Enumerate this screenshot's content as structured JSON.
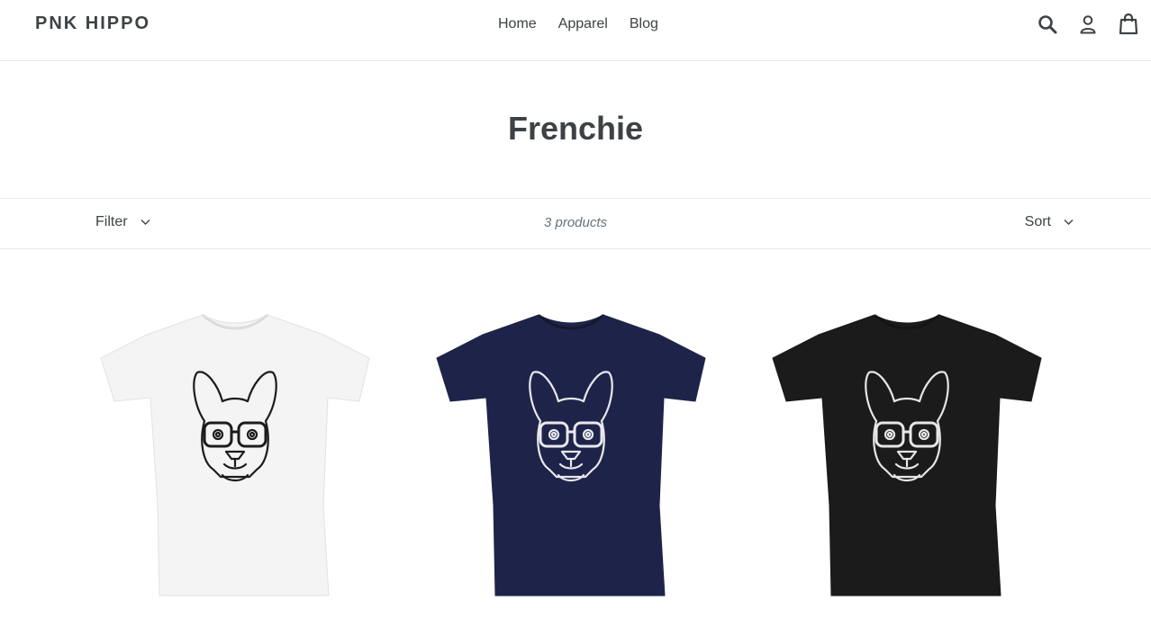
{
  "header": {
    "logo": "PNK HIPPO",
    "nav": [
      "Home",
      "Apparel",
      "Blog"
    ]
  },
  "icons": {
    "search": "search-icon",
    "account": "user-icon",
    "cart": "cart-icon"
  },
  "collection": {
    "title": "Frenchie",
    "filter_label": "Filter",
    "product_count": "3 products",
    "sort_label": "Sort"
  },
  "products": [
    {
      "shirt_color": "#f4f4f4",
      "print_color": "#1c1c1c"
    },
    {
      "shirt_color": "#1e2449",
      "print_color": "#e8e8ee"
    },
    {
      "shirt_color": "#1b1b1b",
      "print_color": "#e6e6e6"
    }
  ]
}
